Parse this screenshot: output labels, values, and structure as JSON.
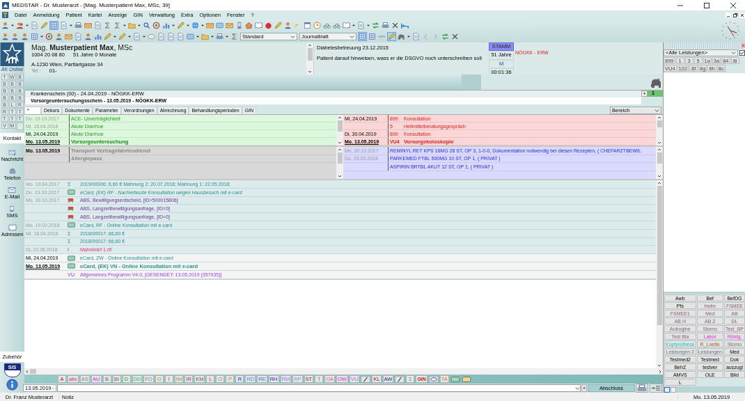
{
  "window": {
    "title": "MEDSTAR - Dr. Musterarzt - [Mag. Musterpatient Max, MSc, 39]"
  },
  "menu": [
    "Datei",
    "Anmeldung",
    "Patient",
    "Kartei",
    "Anzeige",
    "GIN",
    "Verwaltung",
    "Extra",
    "Optionen",
    "Fenster",
    "?"
  ],
  "toolbar": {
    "style_select": "Standard",
    "view_select": "Journalblatt"
  },
  "sidebar": {
    "brand": "ÄK Online",
    "letter_grid": [
      [
        "T",
        "W",
        "B"
      ],
      [
        "B",
        "B",
        "B"
      ],
      [
        "B",
        "B",
        "B"
      ],
      [
        "B",
        "B",
        "B"
      ],
      [
        "B",
        "L",
        "R"
      ],
      [
        "R",
        "T",
        "T"
      ],
      [
        "T",
        "T",
        "T"
      ],
      [
        "V",
        "M"
      ]
    ],
    "tab": "Kontakt",
    "items": [
      {
        "kind": "message",
        "label": "Nachricht"
      },
      {
        "kind": "phone",
        "label": "Telefon"
      },
      {
        "kind": "mail",
        "label": "E-Mail"
      },
      {
        "kind": "sms",
        "label": "SMS"
      },
      {
        "kind": "book",
        "label": "Adressen"
      }
    ],
    "bottom_tab": "Zubehör",
    "sis_label": "SIS"
  },
  "patient": {
    "name": "Mag. **Musterpatient Max**, MSc",
    "number": "1004 20 08 80",
    "age": "51 Jahre 0 Monate",
    "address": "A-1230 Wien, Parttartgasse 34",
    "tel_label": "Tel :",
    "tel": "01-"
  },
  "notes": [
    "Diabetesbetreuung 23.12.2015",
    "Patient darauf hinweisen, wass er die DSGVO noch unterschreiben soll"
  ],
  "status": {
    "badge": "STAMM",
    "age": "51 Jahre",
    "sex": "M",
    "timer": "00:01:36",
    "insurance": "NÖGKK - ERW"
  },
  "counter": "1",
  "scheine_add": "+",
  "scheine": [
    {
      "text": "Krankenschein (00) - 24.04.2019 - NÖGKK-ERW",
      "selected": false
    },
    {
      "text": "Vorsorgeuntersuchungsschein - 13.05.2019 - NÖGKK-ERW",
      "selected": true
    }
  ],
  "tabs": [
    {
      "label": "*",
      "selected": true
    },
    {
      "label": "Dekurs",
      "selected": false
    },
    {
      "label": "Dokumente",
      "selected": false
    },
    {
      "label": "Parameter",
      "selected": false
    },
    {
      "label": "Verordnungen",
      "selected": false
    },
    {
      "label": "Abrechnung",
      "selected": false
    },
    {
      "label": "Behandlungsperioden",
      "selected": false
    },
    {
      "label": "GIN",
      "selected": false
    }
  ],
  "bereich": "Bereich",
  "diagnoses": [
    {
      "date": "Do. 19.10.2017",
      "text": "ACE- Unverträglichkeit",
      "kind": "past"
    },
    {
      "date": "Mi,  18.04.2018",
      "text": "Akute Diarrhoe",
      "kind": "past"
    },
    {
      "date": "Mi,  24.04.2019",
      "text": "Akute Diarrhoe",
      "kind": "normal"
    },
    {
      "date": "Mo. 13.05.2019",
      "text": "Vorsorgeuntersuchung",
      "kind": "today"
    }
  ],
  "services": [
    {
      "date": "Mi,  24.04.2019",
      "code": "899",
      "text": "Konsultation",
      "kind": "normal"
    },
    {
      "code": "5",
      "text": "Heilmittelberatungsgespräch",
      "kind": "normal"
    },
    {
      "date": "Di,  30.04.2019",
      "code": "899",
      "text": "Konsultation",
      "kind": "normal"
    },
    {
      "date": "Mo. 13.05.2019",
      "code": "VU4",
      "text": "Vorsorgekoloskopie",
      "kind": "today"
    }
  ],
  "transport": [
    {
      "date": "Mo. 13.05.2019",
      "text": "Transport Vertragsfahrtendienst"
    },
    {
      "text": "Allergiepass"
    }
  ],
  "medications": [
    {
      "date": "Mo, 30.10.2017",
      "text": "REMINYL RET KPS 16MG 28 ST, OP 3, 1-0-0, Dokumentation notwendig bei diesen Rezepten, ( CHEFARZTBEWIL"
    },
    {
      "date": "Do, 15.03.2018",
      "text": "PARKEMED FTBL 500MG 10 ST, OP 1, ( PRIVAT )"
    },
    {
      "text": "ASPIRIN BRTBL AKUT 12 ST, OP 1, ( PRIVAT )"
    }
  ],
  "journal": [
    {
      "date": "Mo. 10.04.2017",
      "kind": "billing",
      "marker": "Σ",
      "text": "2019/00006: 6,60 € Mahnung 2: 20.07.2018; Mahnung 1: 22.05.2018;",
      "dimmed": true,
      "selected": false,
      "italic": false
    },
    {
      "date": "Do. 19.10.2017",
      "kind": "ecard",
      "text": "eCard, (EK) RF - Nacherfasste Konsultation wegen Hausbesuch mit e-card",
      "dimmed": true,
      "selected": false,
      "italic": true
    },
    {
      "date": "Mo. 30.10.2017",
      "kind": "approval",
      "text": "ABS, Bewilligungsentscheid, [ID=500015806]",
      "dimmed": true,
      "selected": false,
      "italic": false
    },
    {
      "kind": "approval",
      "text": "ABS, Langzeitbewilligungsanfrage, [ID=0]",
      "dimmed": true,
      "selected": false,
      "italic": false
    },
    {
      "kind": "approval",
      "text": "ABS, Langzeitbewilligungsanfrage, [ID=0]",
      "dimmed": true,
      "selected": false,
      "italic": false
    },
    {
      "date": "Mo. 19.02.2018",
      "kind": "ecard",
      "text": "eCard, RF - Online Konsultation mit e-card",
      "dimmed": true,
      "selected": false,
      "italic": false
    },
    {
      "date": "Mi,  18.04.2018",
      "kind": "billing",
      "marker": "Σ",
      "text": "2018/00017: 66,60 €",
      "dimmed": true,
      "selected": false,
      "italic": false
    },
    {
      "kind": "billing",
      "marker": "Σ",
      "text": "2018/00017: 66,60 €",
      "dimmed": true,
      "selected": false,
      "italic": false
    },
    {
      "date": "Di,  22.05.2018",
      "kind": "letter",
      "marker": "I",
      "text": "Mahnbrief 1.rtf",
      "dimmed": true,
      "selected": false,
      "italic": false
    },
    {
      "date": "Mi,  24.04.2019",
      "kind": "ecard",
      "text": "eCard, ZW - Online Konsultation mit e-card",
      "dimmed": false,
      "selected": false,
      "italic": false
    },
    {
      "date": "Mo. 13.05.2019",
      "kind": "ecard",
      "text": "eCard, (EK) VN - Online Konsultation mit e-card",
      "dimmed": false,
      "selected": true,
      "italic": false
    },
    {
      "kind": "program",
      "marker": "VU",
      "text": "Allgemeines Programm V4.0, [GESENDET: 13.05.2019 (357935)]",
      "dimmed": false,
      "selected": false,
      "italic": false
    }
  ],
  "quick_buttons": [
    {
      "kind": "text",
      "label": "A"
    },
    {
      "kind": "text",
      "label": "abc"
    },
    {
      "kind": "text",
      "label": "AS"
    },
    {
      "kind": "text",
      "label": "AU"
    },
    {
      "kind": "text",
      "label": "B"
    },
    {
      "kind": "text",
      "label": "BI"
    },
    {
      "kind": "text",
      "label": "D"
    },
    {
      "kind": "text",
      "label": "DD"
    },
    {
      "kind": "text",
      "label": "FO"
    },
    {
      "kind": "text",
      "label": "G"
    },
    {
      "kind": "text",
      "label": "I"
    },
    {
      "kind": "text",
      "label": "IM"
    },
    {
      "kind": "text",
      "label": "IR"
    },
    {
      "kind": "text",
      "label": "KM"
    },
    {
      "kind": "text",
      "label": "L"
    },
    {
      "kind": "text",
      "label": "O"
    },
    {
      "kind": "text",
      "label": "P"
    },
    {
      "kind": "text",
      "label": "R"
    },
    {
      "kind": "text",
      "label": "RD"
    },
    {
      "kind": "text",
      "label": "RE"
    },
    {
      "kind": "text",
      "label": "RH"
    },
    {
      "kind": "text",
      "label": "RM"
    },
    {
      "kind": "text",
      "label": "RP"
    },
    {
      "kind": "text",
      "label": "ST"
    },
    {
      "kind": "text",
      "label": "T"
    },
    {
      "kind": "text",
      "label": "OA"
    },
    {
      "kind": "text",
      "label": "OW"
    },
    {
      "kind": "text",
      "label": "VU"
    },
    {
      "kind": "pen"
    },
    {
      "kind": "text",
      "label": "KL"
    },
    {
      "kind": "text",
      "label": "AW"
    },
    {
      "kind": "pen"
    },
    {
      "kind": "text",
      "label": "Σ"
    },
    {
      "kind": "gin",
      "label": "GIN"
    },
    {
      "kind": "disc"
    },
    {
      "kind": "text",
      "label": "TA"
    },
    {
      "kind": "card",
      "color": "#a8d8b8"
    },
    {
      "kind": "card",
      "color": "#f0d890"
    }
  ],
  "entry": {
    "date": "13.05.2019",
    "add": "+",
    "submit": "Abschluss"
  },
  "status_bar": {
    "user": "Dr. Franz Musterarzt",
    "note": "Notiz",
    "date": "Mo. 13.05.2019"
  },
  "leistungen": {
    "select": "<Alle Leistungen>",
    "filter_checked": true,
    "chips": [
      [
        "899",
        "1",
        "3",
        "5",
        "1a",
        "3a",
        "84",
        "8i"
      ],
      [
        "VU4",
        "102",
        "8f",
        "8g",
        "8h",
        "8c"
      ]
    ]
  },
  "shortcuts": [
    "Awb",
    "Bef",
    "BefDG",
    "Pfs",
    "Helm",
    "FSMEE",
    "FSMEE1",
    "Med",
    "AB",
    "AB H",
    "AB Z",
    "DL",
    "Aubogine",
    "Storno",
    "Test_BP",
    "Test Bla",
    "Labor",
    "Röntg.",
    "Kopfprothese",
    "R_Loette",
    "Storno",
    "Leistungen 2",
    "Leistungen",
    "Med",
    "Testmed2",
    "Testmed",
    "Dok",
    "BehZ",
    "testver",
    "auszugl",
    "AMVS",
    "OLE",
    "Bild",
    "L"
  ]
}
